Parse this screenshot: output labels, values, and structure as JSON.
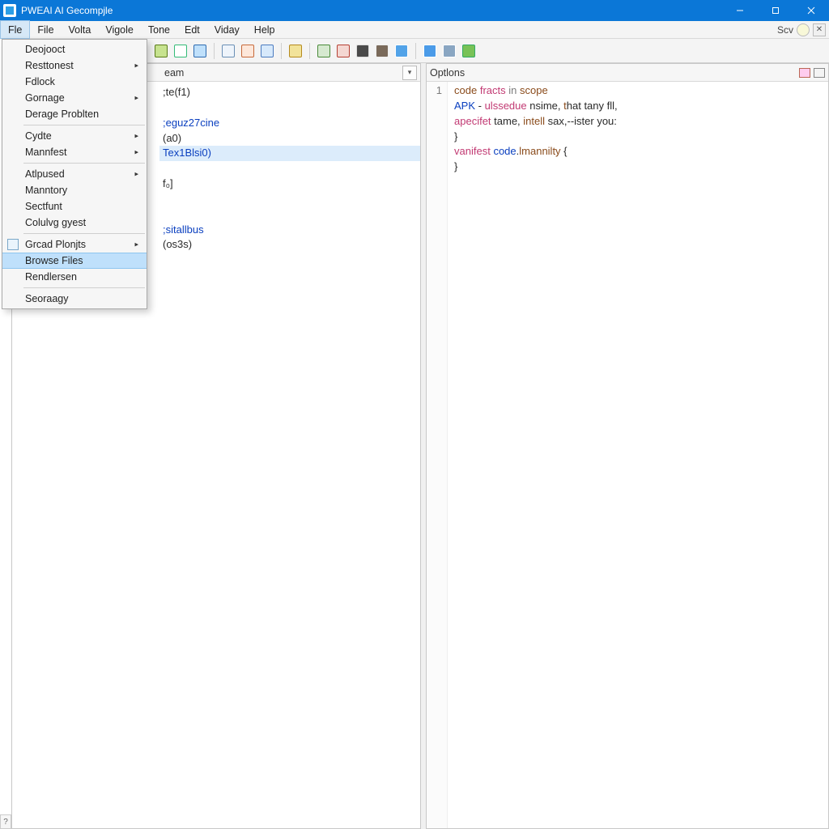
{
  "window": {
    "title": "PWEAI AI Gecompjle"
  },
  "menu": {
    "items": [
      "Fle",
      "File",
      "Volta",
      "Vigole",
      "Tone",
      "Edt",
      "Viday",
      "Help"
    ],
    "active_index": 0
  },
  "right_toolbar": {
    "label": "Scv"
  },
  "dropdown": {
    "items": [
      {
        "label": "Deojooct",
        "submenu": false
      },
      {
        "label": "Resttonest",
        "submenu": true
      },
      {
        "label": "Fdlock",
        "submenu": false
      },
      {
        "label": "Gornage",
        "submenu": true
      },
      {
        "label": "Derage Problten",
        "submenu": false
      },
      {
        "sep": true
      },
      {
        "label": "Cydte",
        "submenu": true
      },
      {
        "label": "Mannfest",
        "submenu": true
      },
      {
        "sep": true
      },
      {
        "label": "Atlpused",
        "submenu": true
      },
      {
        "label": "Manntory",
        "submenu": false
      },
      {
        "label": "Sectfunt",
        "submenu": false
      },
      {
        "label": "Colulvg gyest",
        "submenu": false
      },
      {
        "sep": true
      },
      {
        "label": "Grcad Plonjts",
        "submenu": true,
        "icon": true
      },
      {
        "label": "Browse Files",
        "submenu": false,
        "selected": true
      },
      {
        "label": "Rendlersen",
        "submenu": false
      },
      {
        "sep": true
      },
      {
        "label": "Seoraagy",
        "submenu": false
      }
    ]
  },
  "toolbar_icons": [
    {
      "name": "doc-new-icon",
      "bg": "#c7e38f",
      "fg": "#5a7c1a"
    },
    {
      "name": "chrome-icon",
      "bg": "#ffffff",
      "fg": "#3b7"
    },
    {
      "name": "panel-icon",
      "bg": "#bfe0fb",
      "fg": "#2d6bb0"
    },
    {
      "sep": true
    },
    {
      "name": "table1-icon",
      "bg": "#eef4fb",
      "fg": "#6a8fb5"
    },
    {
      "name": "table2-icon",
      "bg": "#fde7da",
      "fg": "#c7693a"
    },
    {
      "name": "grid-icon",
      "bg": "#d7e9fb",
      "fg": "#4b7bbf"
    },
    {
      "sep": true
    },
    {
      "name": "image-icon",
      "bg": "#f2e39a",
      "fg": "#b58a1e"
    },
    {
      "sep": true
    },
    {
      "name": "picture-icon",
      "bg": "#d6e9d0",
      "fg": "#4a8a3a"
    },
    {
      "name": "bug-icon",
      "bg": "#f4d7d2",
      "fg": "#b64034"
    },
    {
      "name": "gear-dark-icon",
      "bg": "#4a4a4a",
      "fg": "#ddd"
    },
    {
      "name": "cube-icon",
      "bg": "#7a6a5a",
      "fg": "#eee"
    },
    {
      "name": "window-icon",
      "bg": "#52a3e8",
      "fg": "#fff"
    },
    {
      "sep": true
    },
    {
      "name": "globe-icon",
      "bg": "#4b9be8",
      "fg": "#fff"
    },
    {
      "name": "disk-icon",
      "bg": "#8aa6c2",
      "fg": "#fff"
    },
    {
      "name": "android-icon",
      "bg": "#78c257",
      "fg": "#3a6"
    }
  ],
  "nav": {
    "title": "eam",
    "lines": [
      {
        "t": ";te(f1)",
        "cls": ""
      },
      {
        "t": "",
        "cls": ""
      },
      {
        "t": ";eguz27cine",
        "cls": "bl"
      },
      {
        "t": "(a0)",
        "cls": ""
      },
      {
        "t": "Tex1Blsi0)",
        "cls": "bl",
        "hi": true
      },
      {
        "t": "",
        "cls": ""
      },
      {
        "t": "f₀]",
        "cls": ""
      },
      {
        "t": "",
        "cls": ""
      },
      {
        "t": "",
        "cls": ""
      },
      {
        "t": ";sitallbus",
        "cls": "bl"
      },
      {
        "t": "(os3s)",
        "cls": ""
      }
    ]
  },
  "code": {
    "title": "Optlons",
    "line_number": "1",
    "lines": [
      "<span class='brown'>code</span> <span class='pink'>fracts</span> <span class='grey'>in</span> <span class='brown'>scope</span>",
      "<span class='kw'>APK</span> - <span class='pink'>ulssedue</span> nsime, <span class='brown'>t</span>hat tany fll,",
      "<span class='pink'>apecifet</span> tame, <span class='brown'>intell</span> sax,--ister you:",
      "}",
      "<span class='pink'>vanifest</span> <span class='kw'>code</span>.<span class='brown'>lmannilty</span> {",
      "}"
    ]
  },
  "status_hint": "?"
}
